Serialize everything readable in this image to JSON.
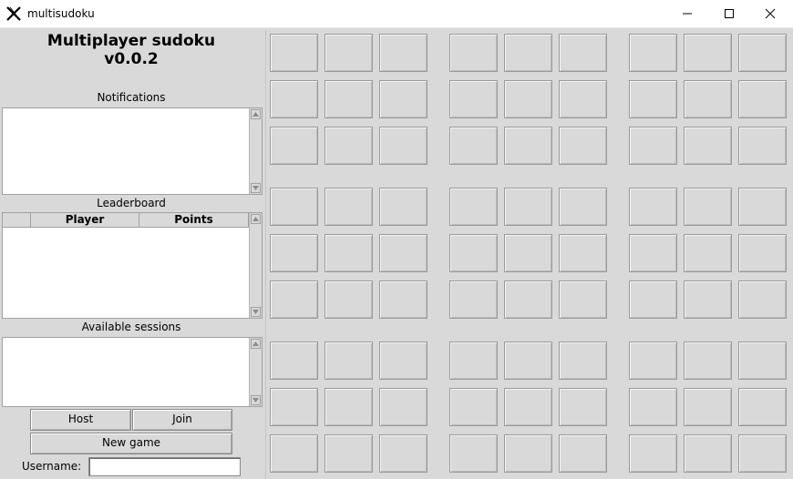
{
  "window": {
    "title": "multisudoku",
    "controls": [
      "minimize",
      "maximize",
      "close"
    ]
  },
  "sidebar": {
    "app_title_line1": "Multiplayer sudoku",
    "app_title_line2": "v0.0.2",
    "notifications_label": "Notifications",
    "leaderboard_label": "Leaderboard",
    "leaderboard_columns": [
      "",
      "Player",
      "Points"
    ],
    "sessions_label": "Available sessions",
    "host_button": "Host",
    "join_button": "Join",
    "new_game_button": "New game",
    "username_label": "Username:",
    "username_value": ""
  },
  "board": {
    "rows": 9,
    "cols": 9,
    "cells": [
      [
        "",
        "",
        "",
        "",
        "",
        "",
        "",
        "",
        ""
      ],
      [
        "",
        "",
        "",
        "",
        "",
        "",
        "",
        "",
        ""
      ],
      [
        "",
        "",
        "",
        "",
        "",
        "",
        "",
        "",
        ""
      ],
      [
        "",
        "",
        "",
        "",
        "",
        "",
        "",
        "",
        ""
      ],
      [
        "",
        "",
        "",
        "",
        "",
        "",
        "",
        "",
        ""
      ],
      [
        "",
        "",
        "",
        "",
        "",
        "",
        "",
        "",
        ""
      ],
      [
        "",
        "",
        "",
        "",
        "",
        "",
        "",
        "",
        ""
      ],
      [
        "",
        "",
        "",
        "",
        "",
        "",
        "",
        "",
        ""
      ],
      [
        "",
        "",
        "",
        "",
        "",
        "",
        "",
        "",
        ""
      ]
    ]
  }
}
